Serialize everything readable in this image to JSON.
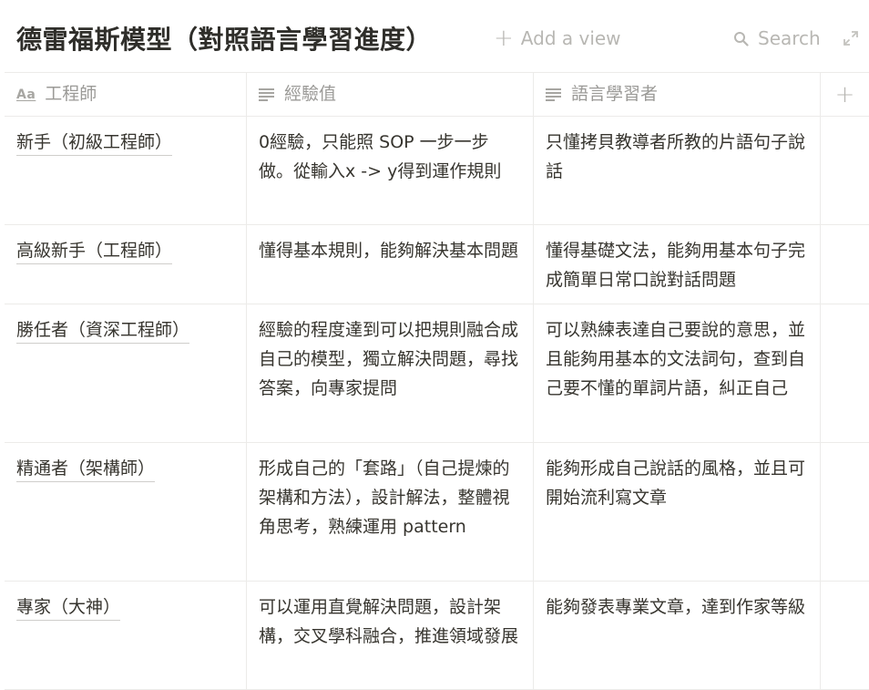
{
  "page": {
    "title": "德雷福斯模型（對照語言學習進度）",
    "add_view_label": "Add a view",
    "search_label": "Search"
  },
  "columns": [
    {
      "label": "工程師",
      "icon": "title-aa-icon"
    },
    {
      "label": "經驗值",
      "icon": "text-lines-icon"
    },
    {
      "label": "語言學習者",
      "icon": "text-lines-icon"
    }
  ],
  "header_icon_text": "Aa",
  "rows": [
    {
      "engineer": "新手（初級工程師）",
      "experience": "0經驗，只能照 SOP 一步一步做。從輸入x -> y得到運作規則",
      "learner": "只懂拷貝教導者所教的片語句子說話"
    },
    {
      "engineer": "高級新手（工程師）",
      "experience": "懂得基本規則，能夠解決基本問題",
      "learner": "懂得基礎文法，能夠用基本句子完成簡單日常口說對話問題"
    },
    {
      "engineer": "勝任者（資深工程師）",
      "experience": "經驗的程度達到可以把規則融合成自己的模型，獨立解決問題，尋找答案，向專家提問",
      "learner": "可以熟練表達自己要說的意思，並且能夠用基本的文法詞句，查到自己要不懂的單詞片語，糾正自己"
    },
    {
      "engineer": "精通者（架構師）",
      "experience": "形成自己的「套路」（自己提煉的架構和方法），設計解法，整體視角思考，熟練運用 pattern",
      "learner": "能夠形成自己說話的風格，並且可開始流利寫文章"
    },
    {
      "engineer": "專家（大神）",
      "experience": "可以運用直覺解決問題，設計架構，交叉學科融合，推進領域發展",
      "learner": "能夠發表專業文章，達到作家等級"
    }
  ]
}
